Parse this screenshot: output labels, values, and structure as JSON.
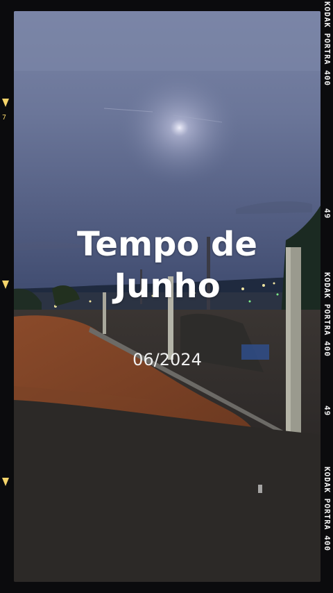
{
  "title_lines": [
    "Tempo de",
    "Junho"
  ],
  "date": "06/2024",
  "film_edge": {
    "brand_text": "KODAK PORTRA 400",
    "frame_number": "49",
    "side_number": "7"
  },
  "colors": {
    "frame": "#0b0b0d",
    "sky": "#5e6b93",
    "accent_marks": "#f5d46a"
  }
}
